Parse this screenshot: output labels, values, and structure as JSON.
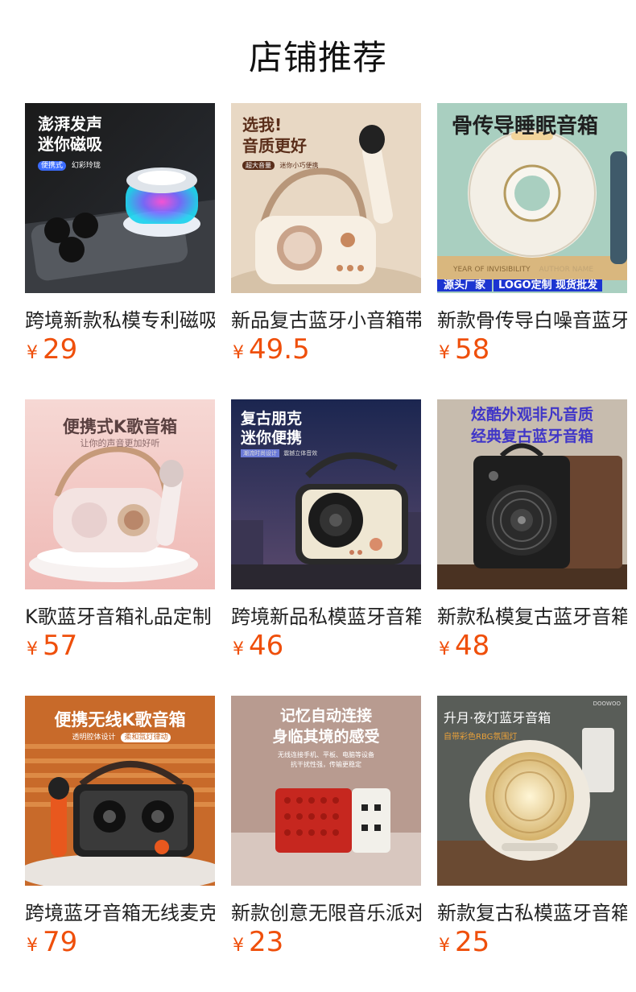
{
  "page": {
    "title": "店铺推荐"
  },
  "currency": "¥",
  "products": [
    {
      "name": "跨境新款私模专利磁吸",
      "price": "29",
      "img_lines": [
        "澎湃发声",
        "迷你磁吸"
      ],
      "img_tags": [
        "便携式",
        "幻彩玲珑"
      ]
    },
    {
      "name": "新品复古蓝牙小音箱带",
      "price": "49.5",
      "img_lines": [
        "选我!",
        "音质更好"
      ],
      "img_tags": [
        "超大音量",
        "迷你小巧便携"
      ]
    },
    {
      "name": "新款骨传导白噪音蓝牙",
      "price": "58",
      "img_lines": [
        "骨传导睡眠音箱"
      ],
      "img_tags": [
        "YEAR OF INVISIBILITY",
        "AUTHOR NAME"
      ],
      "img_footer": [
        "源头厂家",
        "LOGO定制 现货批发"
      ]
    },
    {
      "name": "K歌蓝牙音箱礼品定制",
      "price": "57",
      "img_lines": [
        "便携式K歌音箱",
        "让你的声音更加好听"
      ],
      "img_tags": []
    },
    {
      "name": "跨境新品私模蓝牙音箱",
      "price": "46",
      "img_lines": [
        "复古朋克",
        "迷你便携"
      ],
      "img_tags": [
        "潮流时尚设计",
        "震撼立体音效"
      ]
    },
    {
      "name": "新款私模复古蓝牙音箱",
      "price": "48",
      "img_lines": [
        "炫酷外观非凡音质",
        "经典复古蓝牙音箱"
      ],
      "img_tags": []
    },
    {
      "name": "跨境蓝牙音箱无线麦克",
      "price": "79",
      "img_lines": [
        "便携无线K歌音箱"
      ],
      "img_tags": [
        "透明腔体设计",
        "柔和氛灯律动"
      ]
    },
    {
      "name": "新款创意无限音乐派对",
      "price": "23",
      "img_lines": [
        "记忆自动连接",
        "身临其境的感受"
      ],
      "img_tags": [
        "无线连接手机、平板、电脑等设备",
        "抗干扰性强，传输更稳定"
      ]
    },
    {
      "name": "新款复古私模蓝牙音箱",
      "price": "25",
      "img_lines": [
        "升月·夜灯蓝牙音箱",
        "自带彩色RBG氛围灯"
      ],
      "img_tags": [
        "DOOWOO"
      ]
    }
  ],
  "colors": {
    "price": "#ef4f0b",
    "title": "#111111",
    "name": "#222222"
  }
}
